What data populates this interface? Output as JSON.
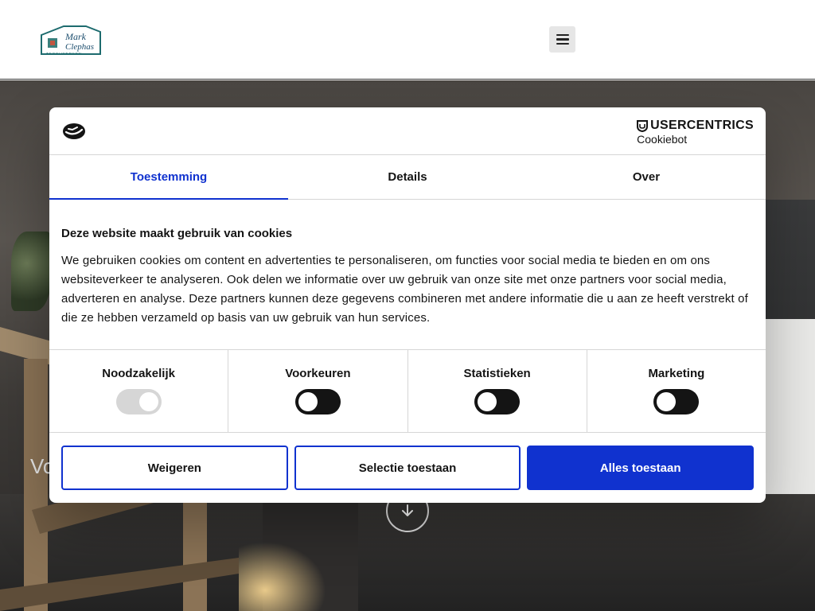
{
  "header": {
    "logo_line1": "Mark",
    "logo_line2": "Clephas",
    "logo_tagline": "TEGELWERKEN",
    "menu_icon": "hamburger-menu-icon"
  },
  "hero": {
    "heading_fragment": "Vo",
    "scroll_icon": "arrow-down-circle-icon"
  },
  "cookie_dialog": {
    "logo_icon": "cookiebot-logo-icon",
    "brand": "USERCENTRICS",
    "brand_sub": "Cookiebot",
    "tabs": [
      {
        "label": "Toestemming",
        "active": true
      },
      {
        "label": "Details",
        "active": false
      },
      {
        "label": "Over",
        "active": false
      }
    ],
    "title": "Deze website maakt gebruik van cookies",
    "description": "We gebruiken cookies om content en advertenties te personaliseren, om functies voor social media te bieden en om ons websiteverkeer te analyseren. Ook delen we informatie over uw gebruik van onze site met onze partners voor social media, adverteren en analyse. Deze partners kunnen deze gegevens combineren met andere informatie die u aan ze heeft verstrekt of die ze hebben verzameld op basis van uw gebruik van hun services.",
    "toggles": [
      {
        "label": "Noodzakelijk",
        "checked": true,
        "disabled": true
      },
      {
        "label": "Voorkeuren",
        "checked": false,
        "disabled": false
      },
      {
        "label": "Statistieken",
        "checked": false,
        "disabled": false
      },
      {
        "label": "Marketing",
        "checked": false,
        "disabled": false
      }
    ],
    "buttons": {
      "reject": "Weigeren",
      "allow_selection": "Selectie toestaan",
      "allow_all": "Alles toestaan"
    },
    "accent_color": "#1032cf"
  }
}
